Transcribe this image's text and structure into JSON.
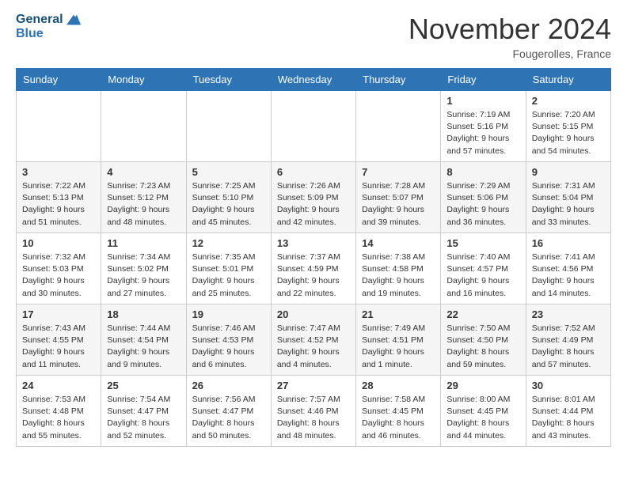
{
  "header": {
    "logo_line1": "General",
    "logo_line2": "Blue",
    "month": "November 2024",
    "location": "Fougerolles, France"
  },
  "weekdays": [
    "Sunday",
    "Monday",
    "Tuesday",
    "Wednesday",
    "Thursday",
    "Friday",
    "Saturday"
  ],
  "weeks": [
    [
      {
        "day": "",
        "detail": ""
      },
      {
        "day": "",
        "detail": ""
      },
      {
        "day": "",
        "detail": ""
      },
      {
        "day": "",
        "detail": ""
      },
      {
        "day": "",
        "detail": ""
      },
      {
        "day": "1",
        "detail": "Sunrise: 7:19 AM\nSunset: 5:16 PM\nDaylight: 9 hours and 57 minutes."
      },
      {
        "day": "2",
        "detail": "Sunrise: 7:20 AM\nSunset: 5:15 PM\nDaylight: 9 hours and 54 minutes."
      }
    ],
    [
      {
        "day": "3",
        "detail": "Sunrise: 7:22 AM\nSunset: 5:13 PM\nDaylight: 9 hours and 51 minutes."
      },
      {
        "day": "4",
        "detail": "Sunrise: 7:23 AM\nSunset: 5:12 PM\nDaylight: 9 hours and 48 minutes."
      },
      {
        "day": "5",
        "detail": "Sunrise: 7:25 AM\nSunset: 5:10 PM\nDaylight: 9 hours and 45 minutes."
      },
      {
        "day": "6",
        "detail": "Sunrise: 7:26 AM\nSunset: 5:09 PM\nDaylight: 9 hours and 42 minutes."
      },
      {
        "day": "7",
        "detail": "Sunrise: 7:28 AM\nSunset: 5:07 PM\nDaylight: 9 hours and 39 minutes."
      },
      {
        "day": "8",
        "detail": "Sunrise: 7:29 AM\nSunset: 5:06 PM\nDaylight: 9 hours and 36 minutes."
      },
      {
        "day": "9",
        "detail": "Sunrise: 7:31 AM\nSunset: 5:04 PM\nDaylight: 9 hours and 33 minutes."
      }
    ],
    [
      {
        "day": "10",
        "detail": "Sunrise: 7:32 AM\nSunset: 5:03 PM\nDaylight: 9 hours and 30 minutes."
      },
      {
        "day": "11",
        "detail": "Sunrise: 7:34 AM\nSunset: 5:02 PM\nDaylight: 9 hours and 27 minutes."
      },
      {
        "day": "12",
        "detail": "Sunrise: 7:35 AM\nSunset: 5:01 PM\nDaylight: 9 hours and 25 minutes."
      },
      {
        "day": "13",
        "detail": "Sunrise: 7:37 AM\nSunset: 4:59 PM\nDaylight: 9 hours and 22 minutes."
      },
      {
        "day": "14",
        "detail": "Sunrise: 7:38 AM\nSunset: 4:58 PM\nDaylight: 9 hours and 19 minutes."
      },
      {
        "day": "15",
        "detail": "Sunrise: 7:40 AM\nSunset: 4:57 PM\nDaylight: 9 hours and 16 minutes."
      },
      {
        "day": "16",
        "detail": "Sunrise: 7:41 AM\nSunset: 4:56 PM\nDaylight: 9 hours and 14 minutes."
      }
    ],
    [
      {
        "day": "17",
        "detail": "Sunrise: 7:43 AM\nSunset: 4:55 PM\nDaylight: 9 hours and 11 minutes."
      },
      {
        "day": "18",
        "detail": "Sunrise: 7:44 AM\nSunset: 4:54 PM\nDaylight: 9 hours and 9 minutes."
      },
      {
        "day": "19",
        "detail": "Sunrise: 7:46 AM\nSunset: 4:53 PM\nDaylight: 9 hours and 6 minutes."
      },
      {
        "day": "20",
        "detail": "Sunrise: 7:47 AM\nSunset: 4:52 PM\nDaylight: 9 hours and 4 minutes."
      },
      {
        "day": "21",
        "detail": "Sunrise: 7:49 AM\nSunset: 4:51 PM\nDaylight: 9 hours and 1 minute."
      },
      {
        "day": "22",
        "detail": "Sunrise: 7:50 AM\nSunset: 4:50 PM\nDaylight: 8 hours and 59 minutes."
      },
      {
        "day": "23",
        "detail": "Sunrise: 7:52 AM\nSunset: 4:49 PM\nDaylight: 8 hours and 57 minutes."
      }
    ],
    [
      {
        "day": "24",
        "detail": "Sunrise: 7:53 AM\nSunset: 4:48 PM\nDaylight: 8 hours and 55 minutes."
      },
      {
        "day": "25",
        "detail": "Sunrise: 7:54 AM\nSunset: 4:47 PM\nDaylight: 8 hours and 52 minutes."
      },
      {
        "day": "26",
        "detail": "Sunrise: 7:56 AM\nSunset: 4:47 PM\nDaylight: 8 hours and 50 minutes."
      },
      {
        "day": "27",
        "detail": "Sunrise: 7:57 AM\nSunset: 4:46 PM\nDaylight: 8 hours and 48 minutes."
      },
      {
        "day": "28",
        "detail": "Sunrise: 7:58 AM\nSunset: 4:45 PM\nDaylight: 8 hours and 46 minutes."
      },
      {
        "day": "29",
        "detail": "Sunrise: 8:00 AM\nSunset: 4:45 PM\nDaylight: 8 hours and 44 minutes."
      },
      {
        "day": "30",
        "detail": "Sunrise: 8:01 AM\nSunset: 4:44 PM\nDaylight: 8 hours and 43 minutes."
      }
    ]
  ]
}
